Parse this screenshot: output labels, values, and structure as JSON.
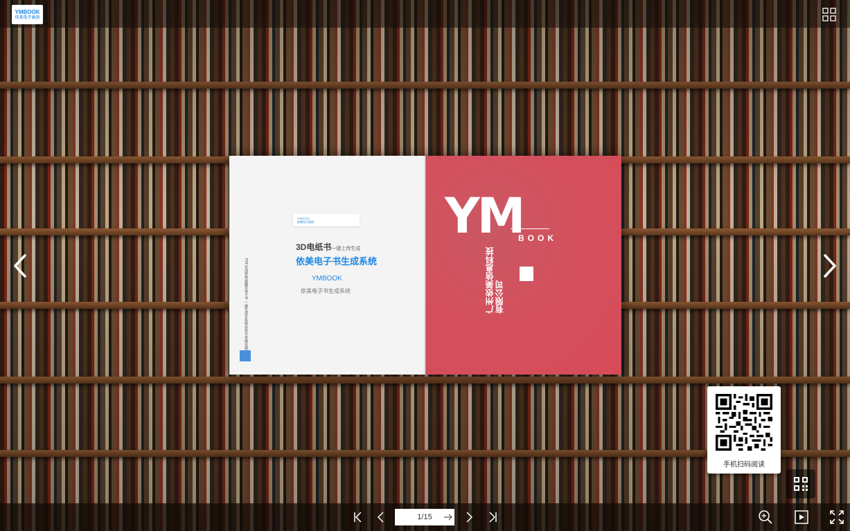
{
  "app": {
    "logo_title": "YMBOOK",
    "logo_sub": "依美电子画册"
  },
  "cover": {
    "left": {
      "banner_line1": "YMBOOK",
      "banner_line2": "依美电子画册",
      "headline_prefix": "3D电纸书",
      "headline_suffix": "一键上传生成",
      "product_name": "依美电子书生成系统",
      "brand": "YMBOOK",
      "brand_sub": "依美电子书生成系统",
      "vertical_text": "PDF在线转换成翻页电子书 一键生成手机版 轻松分享微信朋友圈"
    },
    "right": {
      "big_letters": "YM",
      "book_word": "BOOK",
      "company": "广州依美信息科技有限公司"
    }
  },
  "qr": {
    "label": "手机扫码阅读"
  },
  "toolbar": {
    "page_value": "1/15"
  },
  "colors": {
    "cover_red": "#d64b58",
    "accent_blue": "#1e88e5"
  },
  "icons": [
    "grid-icon",
    "chevron-left-icon",
    "chevron-right-icon",
    "first-page-icon",
    "prev-page-icon",
    "next-page-icon",
    "last-page-icon",
    "go-arrow-icon",
    "zoom-in-icon",
    "play-icon",
    "fullscreen-icon",
    "qr-code-icon"
  ]
}
